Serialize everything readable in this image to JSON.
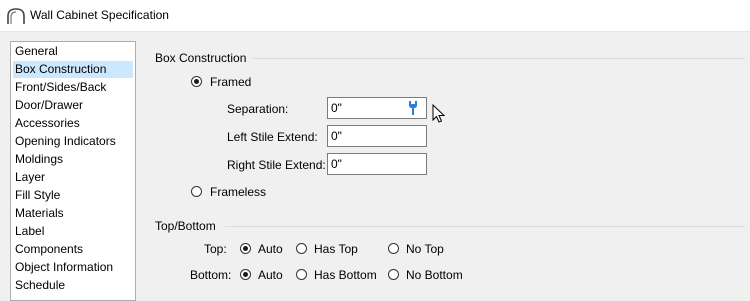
{
  "window": {
    "title": "Wall Cabinet Specification",
    "icon": "app-arc-icon"
  },
  "sidebar": {
    "selected_index": 1,
    "items": [
      {
        "label": "General"
      },
      {
        "label": "Box Construction"
      },
      {
        "label": "Front/Sides/Back"
      },
      {
        "label": "Door/Drawer"
      },
      {
        "label": "Accessories"
      },
      {
        "label": "Opening Indicators"
      },
      {
        "label": "Moldings"
      },
      {
        "label": "Layer"
      },
      {
        "label": "Fill Style"
      },
      {
        "label": "Materials"
      },
      {
        "label": "Label"
      },
      {
        "label": "Components"
      },
      {
        "label": "Object Information"
      },
      {
        "label": "Schedule"
      }
    ]
  },
  "box_construction": {
    "group_label": "Box Construction",
    "framed": {
      "label": "Framed",
      "selected": true
    },
    "separation": {
      "label": "Separation:",
      "value": "0\"",
      "icon": "wrench-icon"
    },
    "left_stile": {
      "label": "Left Stile Extend:",
      "value": "0\""
    },
    "right_stile": {
      "label": "Right Stile Extend:",
      "value": "0\""
    },
    "frameless": {
      "label": "Frameless",
      "selected": false
    }
  },
  "top_bottom": {
    "group_label": "Top/Bottom",
    "top": {
      "label": "Top:",
      "options": [
        {
          "label": "Auto",
          "selected": true
        },
        {
          "label": "Has Top",
          "selected": false
        },
        {
          "label": "No Top",
          "selected": false
        }
      ]
    },
    "bottom": {
      "label": "Bottom:",
      "options": [
        {
          "label": "Auto",
          "selected": true
        },
        {
          "label": "Has Bottom",
          "selected": false
        },
        {
          "label": "No Bottom",
          "selected": false
        }
      ]
    }
  },
  "colors": {
    "selection_highlight": "#cce8ff",
    "dialog_background": "#f0f0f0"
  }
}
